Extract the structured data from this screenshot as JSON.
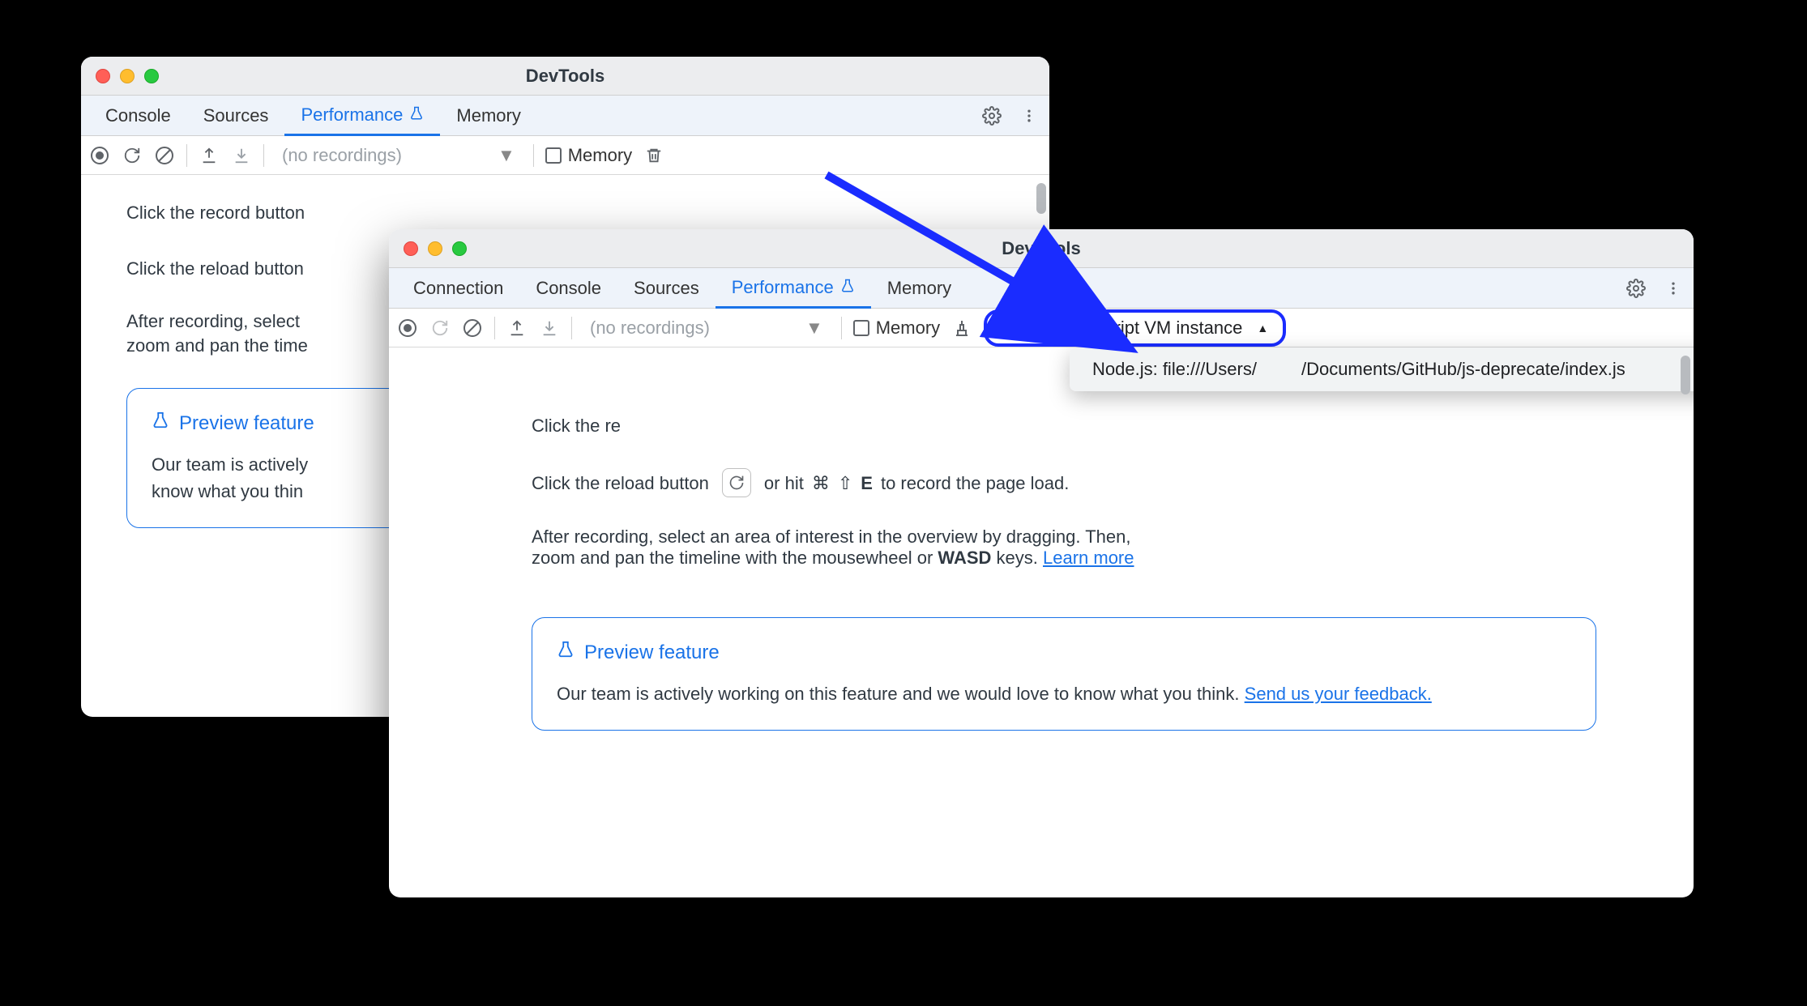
{
  "title": "DevTools",
  "back": {
    "tabs": [
      "Console",
      "Sources",
      "Performance",
      "Memory"
    ],
    "active_tab": 2,
    "select_placeholder": "(no recordings)",
    "memory_label": "Memory",
    "content": {
      "line1": "Click the record button",
      "line2": "Click the reload button",
      "line3": "After recording, select",
      "line4": "zoom and pan the time",
      "preview_title": "Preview feature",
      "preview_body1": "Our team is actively",
      "preview_body2": "know what you thin"
    }
  },
  "front": {
    "tabs": [
      "Connection",
      "Console",
      "Sources",
      "Performance",
      "Memory"
    ],
    "active_tab": 3,
    "select_placeholder": "(no recordings)",
    "memory_label": "Memory",
    "vm_label": "Select JavaScript VM instance",
    "dropdown": {
      "prefix": "Node.js: file:///Users/",
      "suffix": "/Documents/GitHub/js-deprecate/index.js"
    },
    "content": {
      "line1_a": "Click the re",
      "line2_a": "Click the reload button",
      "line2_b": "or hit",
      "line2_cmd": "⌘",
      "line2_shift": "⇧",
      "line2_key": "E",
      "line2_c": "to record the page load.",
      "line3_a": "After recording, select an area of interest in the overview by dragging. Then,",
      "line3_b": "zoom and pan the timeline with the mousewheel or ",
      "line3_wasd": "WASD",
      "line3_c": " keys. ",
      "learn_more": "Learn more",
      "preview_title": "Preview feature",
      "preview_body": "Our team is actively working on this feature and we would love to know what you think. ",
      "feedback_link": "Send us your feedback."
    }
  }
}
